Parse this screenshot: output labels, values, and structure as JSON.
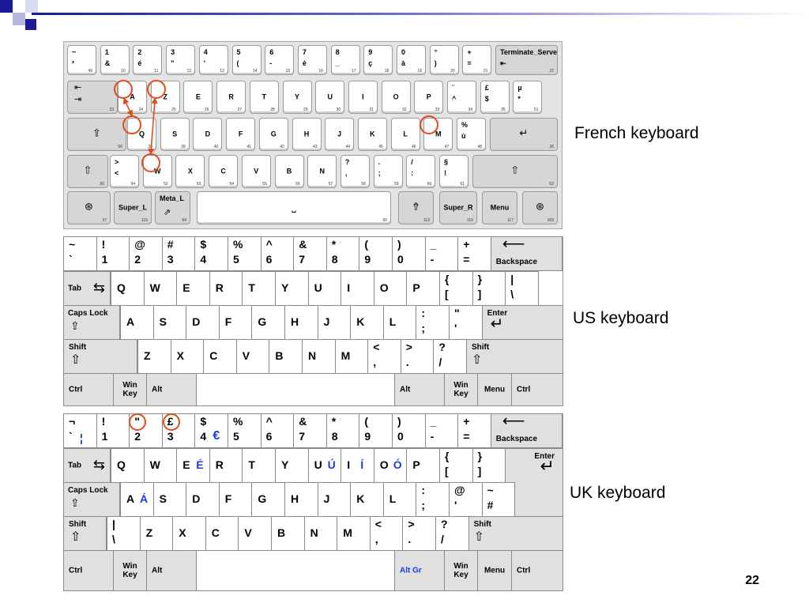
{
  "labels": {
    "french": "French keyboard",
    "us": "US keyboard",
    "uk": "UK keyboard"
  },
  "page_number": "22",
  "colors": {
    "highlight_circle": "#e34b1b",
    "accent_blue": "#1c3be0",
    "header_blue": "#1a1a99"
  },
  "french": {
    "row1": [
      {
        "t": "~",
        "b": "²",
        "n": "49"
      },
      {
        "t": "1",
        "b": "&",
        "n": "10"
      },
      {
        "t": "2",
        "b": "é",
        "n": "11"
      },
      {
        "t": "3",
        "b": "\"",
        "n": "12"
      },
      {
        "t": "4",
        "b": "'",
        "n": "13"
      },
      {
        "t": "5",
        "b": "(",
        "n": "14"
      },
      {
        "t": "6",
        "b": "-",
        "n": "15"
      },
      {
        "t": "7",
        "b": "è",
        "n": "16"
      },
      {
        "t": "8",
        "b": "_",
        "n": "17"
      },
      {
        "t": "9",
        "b": "ç",
        "n": "18"
      },
      {
        "t": "0",
        "b": "à",
        "n": "19"
      },
      {
        "t": "°",
        "b": ")",
        "n": "20"
      },
      {
        "t": "+",
        "b": "=",
        "n": "21"
      }
    ],
    "terminate": {
      "t": "Terminate_Server",
      "b": "⇤",
      "n": "22"
    },
    "tab": {
      "t": "⇤",
      "b": "⇥",
      "n": "23"
    },
    "row2": [
      {
        "c": "A",
        "n": "24"
      },
      {
        "c": "Z",
        "n": "25"
      },
      {
        "c": "E",
        "n": "26"
      },
      {
        "c": "R",
        "n": "27"
      },
      {
        "c": "T",
        "n": "28"
      },
      {
        "c": "Y",
        "n": "29"
      },
      {
        "c": "U",
        "n": "30"
      },
      {
        "c": "I",
        "n": "31"
      },
      {
        "c": "O",
        "n": "32"
      },
      {
        "c": "P",
        "n": "33"
      },
      {
        "t": "¨",
        "b": "^",
        "n": "34"
      },
      {
        "t": "£",
        "b": "$",
        "n": "35"
      },
      {
        "t": "µ",
        "b": "*",
        "n": "51"
      }
    ],
    "caps": {
      "n": "66"
    },
    "row3": [
      {
        "c": "Q",
        "n": "38"
      },
      {
        "c": "S",
        "n": "39"
      },
      {
        "c": "D",
        "n": "40"
      },
      {
        "c": "F",
        "n": "41"
      },
      {
        "c": "G",
        "n": "42"
      },
      {
        "c": "H",
        "n": "43"
      },
      {
        "c": "J",
        "n": "44"
      },
      {
        "c": "K",
        "n": "45"
      },
      {
        "c": "L",
        "n": "46"
      },
      {
        "c": "M",
        "n": "47"
      },
      {
        "t": "%",
        "b": "ù",
        "n": "48"
      }
    ],
    "enter": {
      "n": "36"
    },
    "lshift": {
      "n": "50"
    },
    "row4": [
      {
        "t": ">",
        "b": "<",
        "n": "94"
      },
      {
        "c": "W",
        "n": "52"
      },
      {
        "c": "X",
        "n": "53"
      },
      {
        "c": "C",
        "n": "54"
      },
      {
        "c": "V",
        "n": "55"
      },
      {
        "c": "B",
        "n": "56"
      },
      {
        "c": "N",
        "n": "57"
      },
      {
        "t": "?",
        "b": ",",
        "n": "58"
      },
      {
        "t": ".",
        "b": ";",
        "n": "59"
      },
      {
        "t": "/",
        "b": ":",
        "n": "60"
      },
      {
        "t": "§",
        "b": "!",
        "n": "61"
      }
    ],
    "rshift": {
      "n": "62"
    },
    "row5": {
      "lwin": {
        "n": "37"
      },
      "super_l": {
        "c": "Super_L",
        "n": "115"
      },
      "meta_l": {
        "t": "Meta_L",
        "n": "64"
      },
      "space": {
        "n": "65"
      },
      "altgr": {
        "n": "113"
      },
      "super_r": {
        "c": "Super_R",
        "n": "116"
      },
      "menu": {
        "c": "Menu",
        "n": "117"
      },
      "rwin": {
        "n": "109"
      }
    }
  },
  "us": {
    "row1": [
      {
        "t": "~",
        "b": "`"
      },
      {
        "t": "!",
        "b": "1"
      },
      {
        "t": "@",
        "b": "2"
      },
      {
        "t": "#",
        "b": "3"
      },
      {
        "t": "$",
        "b": "4"
      },
      {
        "t": "%",
        "b": "5"
      },
      {
        "t": "^",
        "b": "6"
      },
      {
        "t": "&",
        "b": "7"
      },
      {
        "t": "*",
        "b": "8"
      },
      {
        "t": "(",
        "b": "9"
      },
      {
        "t": ")",
        "b": "0"
      },
      {
        "t": "_",
        "b": "-"
      },
      {
        "t": "+",
        "b": "="
      }
    ],
    "backspace": "Backspace",
    "tab": "Tab",
    "row2": [
      {
        "m": "Q"
      },
      {
        "m": "W"
      },
      {
        "m": "E"
      },
      {
        "m": "R"
      },
      {
        "m": "T"
      },
      {
        "m": "Y"
      },
      {
        "m": "U"
      },
      {
        "m": "I"
      },
      {
        "m": "O"
      },
      {
        "m": "P"
      },
      {
        "t": "{",
        "b": "["
      },
      {
        "t": "}",
        "b": "]"
      },
      {
        "t": "|",
        "b": "\\"
      }
    ],
    "caps": "Caps Lock",
    "row3": [
      {
        "m": "A"
      },
      {
        "m": "S"
      },
      {
        "m": "D"
      },
      {
        "m": "F"
      },
      {
        "m": "G"
      },
      {
        "m": "H"
      },
      {
        "m": "J"
      },
      {
        "m": "K"
      },
      {
        "m": "L"
      },
      {
        "t": ":",
        "b": ";"
      },
      {
        "t": "\"",
        "b": "'"
      }
    ],
    "enter": "Enter",
    "shift": "Shift",
    "row4": [
      {
        "m": "Z"
      },
      {
        "m": "X"
      },
      {
        "m": "C"
      },
      {
        "m": "V"
      },
      {
        "m": "B"
      },
      {
        "m": "N"
      },
      {
        "m": "M"
      },
      {
        "t": "<",
        "b": ","
      },
      {
        "t": ">",
        "b": "."
      },
      {
        "t": "?",
        "b": "/"
      }
    ],
    "ctrl": "Ctrl",
    "win": "Win\nKey",
    "alt": "Alt",
    "menu": "Menu"
  },
  "uk": {
    "row1": [
      {
        "t": "¬",
        "b": "`",
        "x": "¦"
      },
      {
        "t": "!",
        "b": "1"
      },
      {
        "t": "\"",
        "b": "2"
      },
      {
        "t": "£",
        "b": "3"
      },
      {
        "t": "$",
        "b": "4",
        "x": "€"
      },
      {
        "t": "%",
        "b": "5"
      },
      {
        "t": "^",
        "b": "6"
      },
      {
        "t": "&",
        "b": "7"
      },
      {
        "t": "*",
        "b": "8"
      },
      {
        "t": "(",
        "b": "9"
      },
      {
        "t": ")",
        "b": "0"
      },
      {
        "t": "_",
        "b": "-"
      },
      {
        "t": "+",
        "b": "="
      }
    ],
    "backspace": "Backspace",
    "tab": "Tab",
    "row2": [
      {
        "m": "Q"
      },
      {
        "m": "W"
      },
      {
        "m": "E",
        "x": "É"
      },
      {
        "m": "R"
      },
      {
        "m": "T"
      },
      {
        "m": "Y"
      },
      {
        "m": "U",
        "x": "Ú"
      },
      {
        "m": "I",
        "x": "Í"
      },
      {
        "m": "O",
        "x": "Ó"
      },
      {
        "m": "P"
      },
      {
        "t": "{",
        "b": "["
      },
      {
        "t": "}",
        "b": "]"
      }
    ],
    "enter": "Enter",
    "caps": "Caps Lock",
    "row3": [
      {
        "m": "A",
        "x": "Á"
      },
      {
        "m": "S"
      },
      {
        "m": "D"
      },
      {
        "m": "F"
      },
      {
        "m": "G"
      },
      {
        "m": "H"
      },
      {
        "m": "J"
      },
      {
        "m": "K"
      },
      {
        "m": "L"
      },
      {
        "t": ":",
        "b": ";"
      },
      {
        "t": "@",
        "b": "'"
      },
      {
        "t": "~",
        "b": "#"
      }
    ],
    "shift": "Shift",
    "row4": [
      {
        "t": "|",
        "b": "\\"
      },
      {
        "m": "Z"
      },
      {
        "m": "X"
      },
      {
        "m": "C"
      },
      {
        "m": "V"
      },
      {
        "m": "B"
      },
      {
        "m": "N"
      },
      {
        "m": "M"
      },
      {
        "t": "<",
        "b": ","
      },
      {
        "t": ">",
        "b": "."
      },
      {
        "t": "?",
        "b": "/"
      }
    ],
    "ctrl": "Ctrl",
    "win": "Win\nKey",
    "alt": "Alt",
    "altgr": "Alt Gr",
    "menu": "Menu"
  }
}
